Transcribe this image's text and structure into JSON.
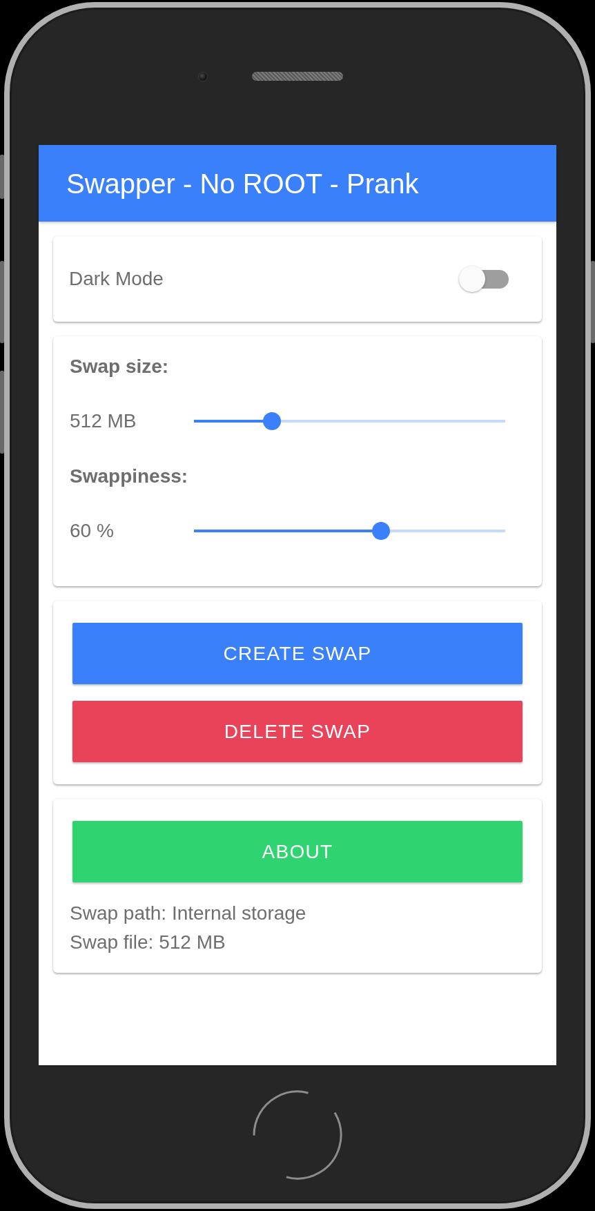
{
  "app_bar": {
    "title": "Swapper - No ROOT - Prank"
  },
  "dark_mode": {
    "label": "Dark Mode",
    "on": false
  },
  "swap_settings": {
    "sliders": [
      {
        "label": "Swap size:",
        "reading": "512 MB",
        "level": 0.25
      },
      {
        "label": "Swappiness:",
        "reading": "60 %",
        "level": 0.6
      }
    ]
  },
  "actions": [
    {
      "label": "CREATE SWAP",
      "kind": "primary"
    },
    {
      "label": "DELETE SWAP",
      "kind": "danger"
    }
  ],
  "about": {
    "button": {
      "label": "ABOUT",
      "kind": "success"
    },
    "info": [
      "Swap path: Internal storage",
      "Swap file: 512 MB"
    ]
  }
}
